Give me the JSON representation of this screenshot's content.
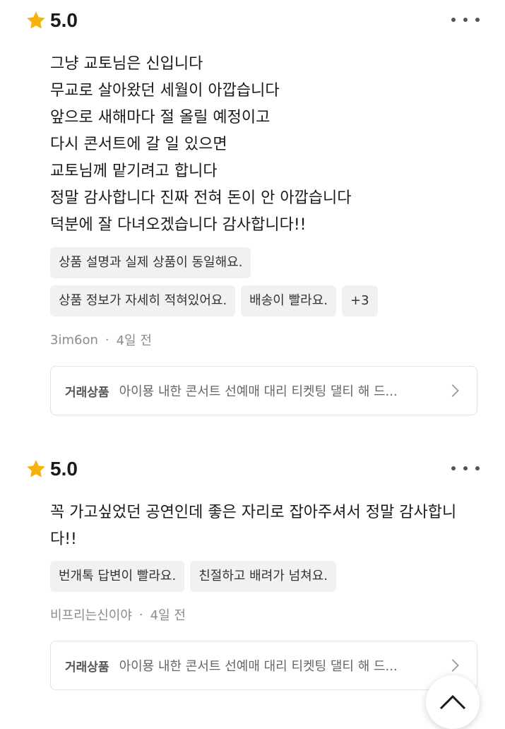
{
  "reviews": [
    {
      "rating": "5.0",
      "body": "그냥 교토님은 신입니다\n무교로 살아왔던 세월이 아깝습니다\n앞으로 새해마다 절 올릴 예정이고\n다시 콘서트에 갈 일 있으면\n교토님께 맡기려고 합니다\n정말 감사합니다 진짜 전혀 돈이 안 아깝습니다\n덕분에 잘 다녀오겠습니다 감사합니다!!",
      "tags": [
        "상품 설명과 실제 상품이 동일해요.",
        "상품 정보가 자세히 적혀있어요.",
        "배송이 빨라요.",
        "+3"
      ],
      "author": "3im6on",
      "time": "4일 전",
      "product_label": "거래상품",
      "product_name": "아이묭 내한 콘서트 선예매 대리 티켓팅 댈티 해 드..."
    },
    {
      "rating": "5.0",
      "body": "꼭 가고싶었던 공연인데 좋은 자리로 잡아주셔서 정말 감사합니다!!",
      "tags": [
        "번개톡 답변이 빨라요.",
        "친절하고 배려가 넘쳐요."
      ],
      "author": "비프리는신이야",
      "time": "4일 전",
      "product_label": "거래상품",
      "product_name": "아이묭 내한 콘서트 선예매 대리 티켓팅 댈티 해 드..."
    }
  ],
  "icons": {
    "star": "star-icon",
    "more": "more-options-icon",
    "chevron": "chevron-right-icon",
    "scroll_top": "chevron-up-icon"
  },
  "colors": {
    "star": "#F5B30A",
    "tag_bg": "#F1F1F1",
    "meta_text": "#8B8B8B",
    "card_border": "#E2E2E2"
  }
}
